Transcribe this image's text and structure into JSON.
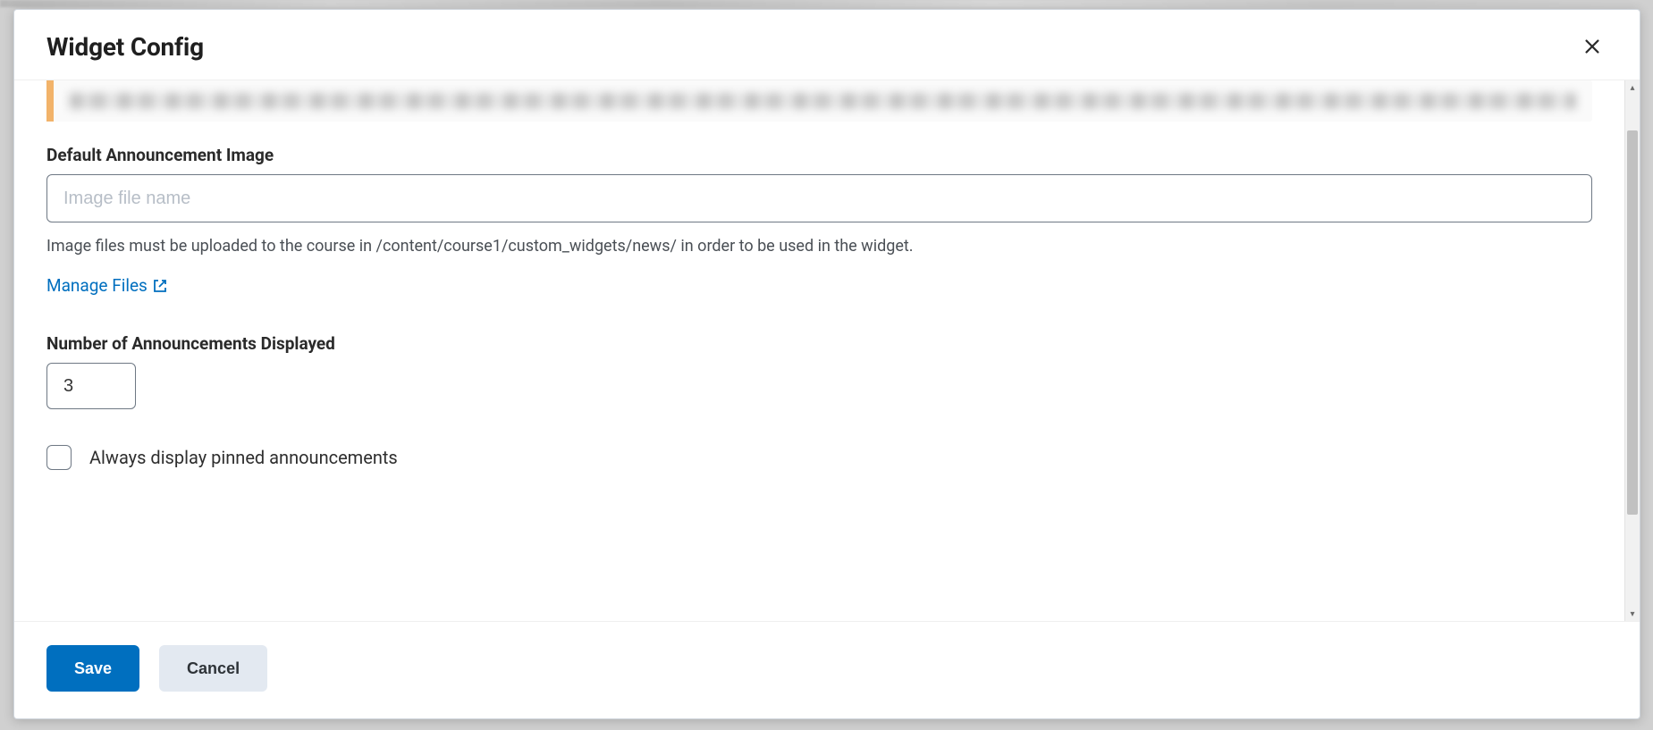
{
  "dialog": {
    "title": "Widget Config"
  },
  "fields": {
    "default_image": {
      "label": "Default Announcement Image",
      "placeholder": "Image file name",
      "value": "",
      "help": "Image files must be uploaded to the course in /content/course1/custom_widgets/news/ in order to be used in the widget."
    },
    "manage_files_link": "Manage Files",
    "num_announcements": {
      "label": "Number of Announcements Displayed",
      "value": "3"
    },
    "always_pinned": {
      "label": "Always display pinned announcements",
      "checked": false
    }
  },
  "footer": {
    "save": "Save",
    "cancel": "Cancel"
  }
}
